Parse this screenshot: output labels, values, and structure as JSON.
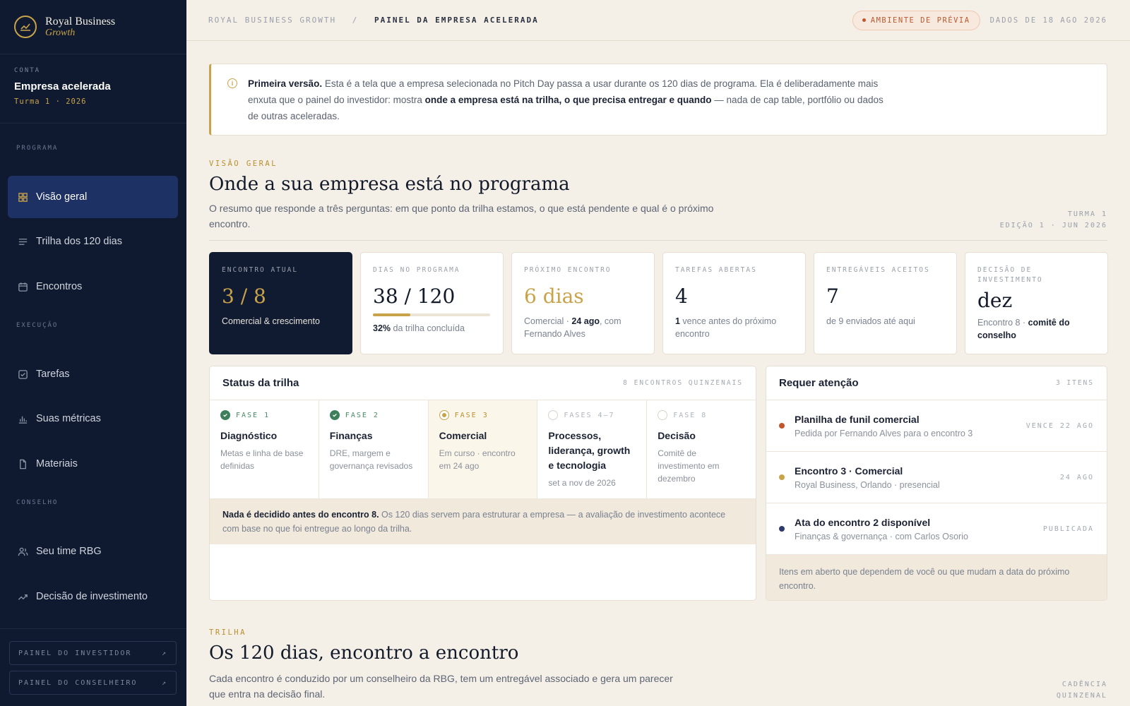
{
  "sidebar": {
    "brand_line1": "Royal Business",
    "brand_line2": "Growth",
    "account_label": "CONTA",
    "account_name": "Empresa acelerada",
    "account_sub": "Turma 1 · 2026",
    "sections": [
      "PROGRAMA",
      "EXECUÇÃO",
      "CONSELHO"
    ],
    "items": [
      {
        "label": "Visão geral",
        "icon": "grid-icon",
        "active": true
      },
      {
        "label": "Trilha dos 120 dias",
        "icon": "list-icon"
      },
      {
        "label": "Encontros",
        "icon": "calendar-icon"
      },
      {
        "label": "Tarefas",
        "icon": "checkbox-icon"
      },
      {
        "label": "Suas métricas",
        "icon": "bar-chart-icon"
      },
      {
        "label": "Materiais",
        "icon": "document-icon"
      },
      {
        "label": "Seu time RBG",
        "icon": "people-icon"
      },
      {
        "label": "Decisão de investimento",
        "icon": "trend-icon"
      }
    ],
    "footer_buttons": [
      "PAINEL DO INVESTIDOR",
      "PAINEL DO CONSELHEIRO"
    ]
  },
  "topbar": {
    "crumb_root": "ROYAL BUSINESS GROWTH",
    "crumb_sep": "/",
    "crumb_current": "PAINEL DA EMPRESA ACELERADA",
    "preview_badge": "AMBIENTE DE PRÉVIA",
    "data_date": "DADOS DE 18 AGO 2026"
  },
  "notice": {
    "bold": "Primeira versão.",
    "text1": " Esta é a tela que a empresa selecionada no Pitch Day passa a usar durante os 120 dias de programa. Ela é deliberadamente mais enxuta que o painel do investidor: mostra ",
    "bold2": "onde a empresa está na trilha, o que precisa entregar e quando",
    "text2": " — nada de cap table, portfólio ou dados de outras aceleradas."
  },
  "overview": {
    "eyebrow": "VISÃO GERAL",
    "title": "Onde a sua empresa está no programa",
    "lead": "O resumo que responde a três perguntas: em que ponto da trilha estamos, o que está pendente e qual é o próximo encontro.",
    "meta1": "TURMA 1",
    "meta2": "EDIÇÃO 1 · JUN 2026"
  },
  "kpis": [
    {
      "label": "ENCONTRO ATUAL",
      "value": "3 / 8",
      "desc": "Comercial & crescimento"
    },
    {
      "label": "DIAS NO PROGRAMA",
      "value": "38 / 120",
      "progress": 0.32,
      "desc_bold": "32%",
      "desc": " da trilha concluída"
    },
    {
      "label": "PRÓXIMO ENCONTRO",
      "value": "6 dias",
      "desc_a": "Comercial · ",
      "desc_bold": "24 ago",
      "desc_b": ", com Fernando Alves"
    },
    {
      "label": "TAREFAS ABERTAS",
      "value": "4",
      "desc_bold": "1",
      "desc": " vence antes do próximo encontro"
    },
    {
      "label": "ENTREGÁVEIS ACEITOS",
      "value": "7",
      "desc": "de 9 enviados até aqui"
    },
    {
      "label": "DECISÃO DE INVESTIMENTO",
      "value": "dez",
      "desc": "Encontro 8 · ",
      "desc_bold": "comitê do conselho"
    }
  ],
  "status": {
    "title": "Status da trilha",
    "right": "8 ENCONTROS QUINZENAIS",
    "phases": [
      {
        "label": "FASE 1",
        "name": "Diagnóstico",
        "desc": "Metas e linha de base definidas",
        "state": "done"
      },
      {
        "label": "FASE 2",
        "name": "Finanças",
        "desc": "DRE, margem e governança revisados",
        "state": "done"
      },
      {
        "label": "FASE 3",
        "name": "Comercial",
        "desc": "Em curso · encontro em 24 ago",
        "state": "current"
      },
      {
        "label": "FASES 4–7",
        "name": "Processos, liderança, growth e tecnologia",
        "desc": "set a nov de 2026",
        "state": "todo"
      },
      {
        "label": "FASE 8",
        "name": "Decisão",
        "desc": "Comitê de investimento em dezembro",
        "state": "todo"
      }
    ],
    "note_bold": "Nada é decidido antes do encontro 8.",
    "note": " Os 120 dias servem para estruturar a empresa — a avaliação de investimento acontece com base no que foi entregue ao longo da trilha."
  },
  "attention": {
    "title": "Requer atenção",
    "right": "3 ITENS",
    "items": [
      {
        "title": "Planilha de funil comercial",
        "sub": "Pedida por Fernando Alves para o encontro 3",
        "tag": "VENCE 22 AGO",
        "color": "#c2552a"
      },
      {
        "title": "Encontro 3 · Comercial",
        "sub": "Royal Business, Orlando · presencial",
        "tag": "24 AGO",
        "color": "#c9a34a"
      },
      {
        "title": "Ata do encontro 2 disponível",
        "sub": "Finanças & governança · com Carlos Osorio",
        "tag": "PUBLICADA",
        "color": "#2d3a6e"
      }
    ],
    "note": "Itens em aberto que dependem de você ou que mudam a data do próximo encontro."
  },
  "trail": {
    "eyebrow": "TRILHA",
    "title": "Os 120 dias, encontro a encontro",
    "lead": "Cada encontro é conduzido por um conselheiro da RBG, tem um entregável associado e gera um parecer que entra na decisão final.",
    "meta1": "CADÊNCIA",
    "meta2": "QUINZENAL"
  },
  "colors": {
    "sidebar": "#0f1a30",
    "accent_gold": "#c9a34a",
    "active_nav": "#1d3164",
    "background": "#f4efe7",
    "done_green": "#3d7f5a"
  }
}
